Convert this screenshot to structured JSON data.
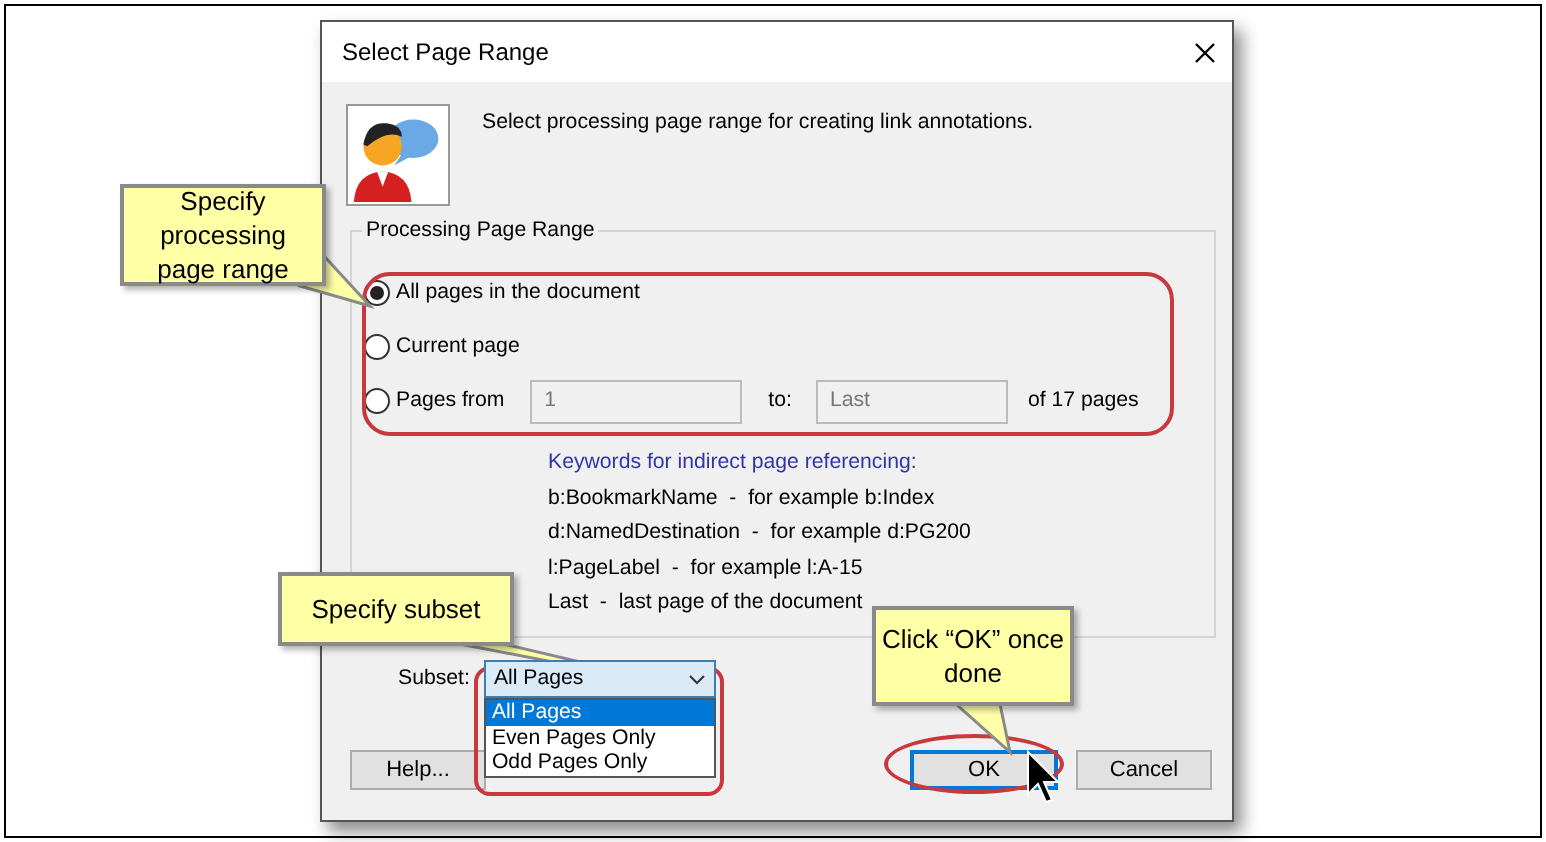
{
  "window": {
    "title": "Select Page Range"
  },
  "intro": "Select processing page range for creating link annotations.",
  "range_group": {
    "title": "Processing Page Range",
    "options": [
      {
        "label": "All pages in the document",
        "selected": true
      },
      {
        "label": "Current page",
        "selected": false
      },
      {
        "label": "Pages from",
        "selected": false
      }
    ],
    "from_value": "1",
    "to_label": "to:",
    "to_value": "Last",
    "page_count": "of 17 pages"
  },
  "keywords": {
    "heading": "Keywords for indirect page referencing:",
    "lines": [
      "b:BookmarkName  -  for example b:Index",
      "d:NamedDestination  -  for example d:PG200",
      "l:PageLabel  -  for example l:A-15",
      "Last  -  last page of the document"
    ]
  },
  "subset": {
    "label": "Subset:",
    "value": "All Pages",
    "options": [
      {
        "label": "All Pages",
        "selected": true
      },
      {
        "label": "Even Pages Only",
        "selected": false
      },
      {
        "label": "Odd Pages Only",
        "selected": false
      }
    ]
  },
  "buttons": [
    {
      "label": "Help...",
      "default": false
    },
    {
      "label": "OK",
      "default": true
    },
    {
      "label": "Cancel",
      "default": false
    }
  ],
  "callouts": [
    {
      "text": "Specify processing page range"
    },
    {
      "text": "Specify subset"
    },
    {
      "text": "Click “OK” once done"
    }
  ]
}
